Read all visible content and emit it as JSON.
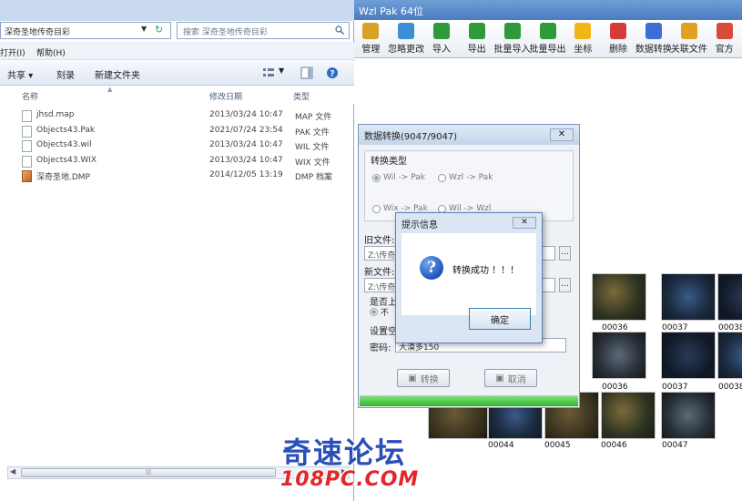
{
  "app": {
    "title": "Wzl  Pak  64位",
    "toolbar": [
      {
        "label": "管理",
        "icon": "manage-icon",
        "color": "#d9a227"
      },
      {
        "label": "忽略更改",
        "icon": "ignore-icon",
        "color": "#3b8fd6"
      },
      {
        "label": "导入",
        "icon": "import-icon",
        "color": "#2f9a3a"
      },
      {
        "label": "导出",
        "icon": "export-icon",
        "color": "#2f9a3a"
      },
      {
        "label": "批量导入",
        "icon": "batch-import-icon",
        "color": "#2f9a3a"
      },
      {
        "label": "批量导出",
        "icon": "batch-export-icon",
        "color": "#2f9a3a"
      },
      {
        "label": "坐标",
        "icon": "star-icon",
        "color": "#f2b515"
      },
      {
        "label": "删除",
        "icon": "delete-icon",
        "color": "#d63b3b"
      },
      {
        "label": "数据转换",
        "icon": "convert-icon",
        "color": "#3b6fd6"
      },
      {
        "label": "关联文件",
        "icon": "link-icon",
        "color": "#e0a020"
      },
      {
        "label": "官方",
        "icon": "official-icon",
        "color": "#d64b3b"
      }
    ],
    "thumbs": [
      "00036",
      "00037",
      "00038",
      "00036",
      "00037",
      "00038",
      "00044",
      "00045",
      "00046",
      "00047"
    ]
  },
  "conv": {
    "title": "数据转换(9047/9047)",
    "close": "✕",
    "group_title": "转换类型",
    "options": [
      "Wil -> Pak",
      "Wzl -> Pak",
      "Wix -> Pak",
      "Wil -> Wzl"
    ],
    "old_label": "旧文件:",
    "old_value": "Z:\\传奇",
    "new_label": "新文件:",
    "new_value": "Z:\\传奇",
    "overwrite_label": "是否上",
    "overwrite_opt": "不",
    "settings_label": "设置空",
    "density_label": "密码:",
    "density_value": "大漠多150",
    "convert_btn": "转换",
    "cancel_btn": "取消",
    "progress": 1.0
  },
  "msg": {
    "title": "提示信息",
    "close": "✕",
    "text": "转换成功 ！！！",
    "ok": "确定"
  },
  "explorer": {
    "address": "深奇圣地传奇目彩",
    "search_placeholder": "搜索 深奇圣地传奇目彩",
    "menu": [
      "打开(I)",
      "帮助(H)"
    ],
    "commands": [
      "共享 ▾",
      "刻录",
      "新建文件夹"
    ],
    "columns": {
      "name": "名称",
      "date": "修改日期",
      "type": "类型"
    },
    "files": [
      {
        "name": "jhsd.map",
        "date": "2013/03/24 10:47",
        "type": "MAP 文件",
        "icon": "file-icon"
      },
      {
        "name": "Objects43.Pak",
        "date": "2021/07/24 23:54",
        "type": "PAK 文件",
        "icon": "file-icon"
      },
      {
        "name": "Objects43.wil",
        "date": "2013/03/24 10:47",
        "type": "WIL 文件",
        "icon": "file-icon"
      },
      {
        "name": "Objects43.WIX",
        "date": "2013/03/24 10:47",
        "type": "WIX 文件",
        "icon": "file-icon"
      },
      {
        "name": "深奇圣地.DMP",
        "date": "2014/12/05 13:19",
        "type": "DMP 档案",
        "icon": "dmp-icon"
      }
    ]
  },
  "watermark": {
    "title": "奇速论坛",
    "site": "108PC.COM"
  }
}
